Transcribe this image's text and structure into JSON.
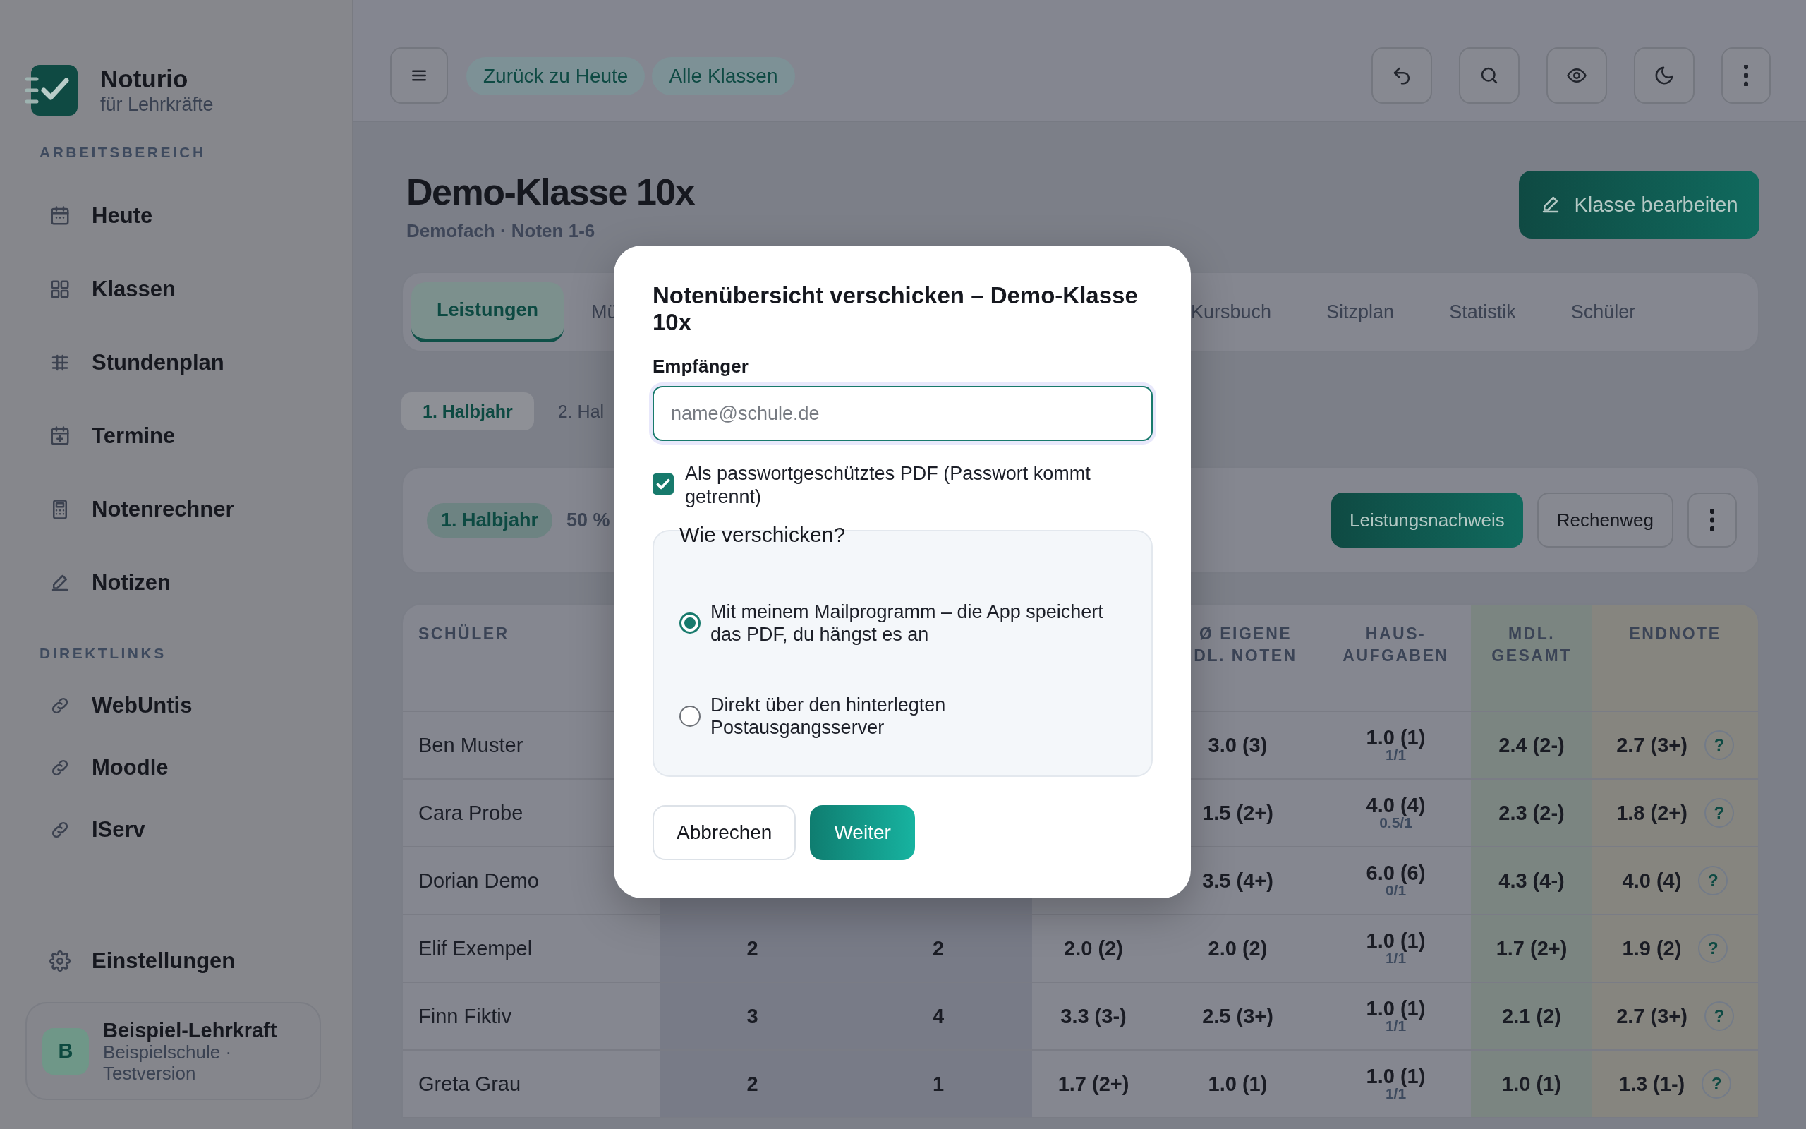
{
  "sidebar": {
    "brand": {
      "name": "Noturio",
      "subtitle": "für Lehrkräfte"
    },
    "sections": [
      {
        "heading": "ARBEITSBEREICH",
        "items": [
          {
            "label": "Heute"
          },
          {
            "label": "Klassen"
          },
          {
            "label": "Stundenplan"
          },
          {
            "label": "Termine"
          },
          {
            "label": "Notenrechner"
          },
          {
            "label": "Notizen"
          }
        ]
      },
      {
        "heading": "DIREKTLINKS",
        "items": [
          {
            "label": "WebUntis"
          },
          {
            "label": "Moodle"
          },
          {
            "label": "IServ"
          }
        ]
      }
    ],
    "settings": {
      "label": "Einstellungen"
    },
    "user": {
      "initial": "B",
      "name": "Beispiel-Lehrkraft",
      "subtitle": "Beispielschule · Testversion"
    }
  },
  "topbar": {
    "chips": [
      "Zurück zu Heute",
      "Alle Klassen"
    ]
  },
  "class_header": {
    "title": "Demo-Klasse 10x",
    "subtitle": "Demofach · Noten 1-6",
    "edit_button": "Klasse bearbeiten"
  },
  "tabs": {
    "left": [
      {
        "label": "Leistungen",
        "selected": true
      },
      {
        "label": "Mü",
        "selected": false
      }
    ],
    "right": [
      {
        "label": "Kursbuch",
        "selected": false
      },
      {
        "label": "Sitzplan",
        "selected": false
      },
      {
        "label": "Statistik",
        "selected": false
      },
      {
        "label": "Schüler",
        "selected": false
      }
    ]
  },
  "semesters": [
    {
      "label": "1. Halbjahr",
      "selected": true
    },
    {
      "label": "2. Hal",
      "selected": false
    }
  ],
  "summary": {
    "period": "1. Halbjahr",
    "weight": "50 %",
    "buttons": [
      {
        "label": "Leistungsnachweis",
        "kind": "primary"
      },
      {
        "label": "Rechenweg",
        "kind": "secondary"
      }
    ]
  },
  "table": {
    "headers": {
      "student": [
        "SCHÜLER"
      ],
      "eigene": [
        "Ø EIGENE",
        "DL. NOTEN"
      ],
      "hausaufgaben": [
        "HAUS-",
        "AUFGABEN"
      ],
      "mdl_gesamt": [
        "MDL.",
        "GESAMT"
      ],
      "endnote": [
        "ENDNOTE"
      ]
    },
    "rows": [
      {
        "name": "Ben Muster",
        "eigene": "3.0 (3)",
        "hausaufgaben": {
          "value": "1.0 (1)",
          "sub": "1/1"
        },
        "mdl_gesamt": "2.4 (2-)",
        "endnote": "2.7 (3+)",
        "help": "?"
      },
      {
        "name": "Cara Probe",
        "eigene": "1.5 (2+)",
        "hausaufgaben": {
          "value": "4.0 (4)",
          "sub": "0.5/1"
        },
        "mdl_gesamt": "2.3 (2-)",
        "endnote": "1.8 (2+)",
        "help": "?"
      },
      {
        "name": "Dorian Demo",
        "eigene": "3.5 (4+)",
        "hausaufgaben": {
          "value": "6.0 (6)",
          "sub": "0/1"
        },
        "mdl_gesamt": "4.3 (4-)",
        "endnote": "4.0 (4)",
        "help": "?"
      },
      {
        "name": "Elif Exempel",
        "col_2": "2",
        "col_3": "2",
        "col_4": "2.0 (2)",
        "eigene": "2.0 (2)",
        "hausaufgaben": {
          "value": "1.0 (1)",
          "sub": "1/1"
        },
        "mdl_gesamt": "1.7 (2+)",
        "endnote": "1.9 (2)",
        "help": "?"
      },
      {
        "name": "Finn Fiktiv",
        "col_2": "3",
        "col_3": "4",
        "col_4": "3.3 (3-)",
        "eigene": "2.5 (3+)",
        "hausaufgaben": {
          "value": "1.0 (1)",
          "sub": "1/1"
        },
        "mdl_gesamt": "2.1 (2)",
        "endnote": "2.7 (3+)",
        "help": "?"
      },
      {
        "name": "Greta Grau",
        "col_2": "2",
        "col_3": "1",
        "col_4": "1.7 (2+)",
        "eigene": "1.0 (1)",
        "hausaufgaben": {
          "value": "1.0 (1)",
          "sub": "1/1"
        },
        "mdl_gesamt": "1.0 (1)",
        "endnote": "1.3 (1-)",
        "help": "?"
      }
    ]
  },
  "dialog": {
    "title": "Notenübersicht verschicken – Demo-Klasse 10x",
    "recipient": {
      "label": "Empfänger",
      "placeholder": "name@schule.de"
    },
    "password_pdf": {
      "label": "Als passwortgeschütztes PDF (Passwort kommt getrennt)",
      "checked": true
    },
    "method": {
      "legend": "Wie verschicken?",
      "options": [
        {
          "label": "Mit meinem Mailprogramm – die App speichert das PDF, du hängst es an",
          "selected": true
        },
        {
          "label": "Direkt über den hinterlegten Postausgangsserver",
          "selected": false
        }
      ]
    },
    "buttons": [
      {
        "label": "Abbrechen",
        "kind": "secondary"
      },
      {
        "label": "Weiter",
        "kind": "primary"
      }
    ]
  }
}
